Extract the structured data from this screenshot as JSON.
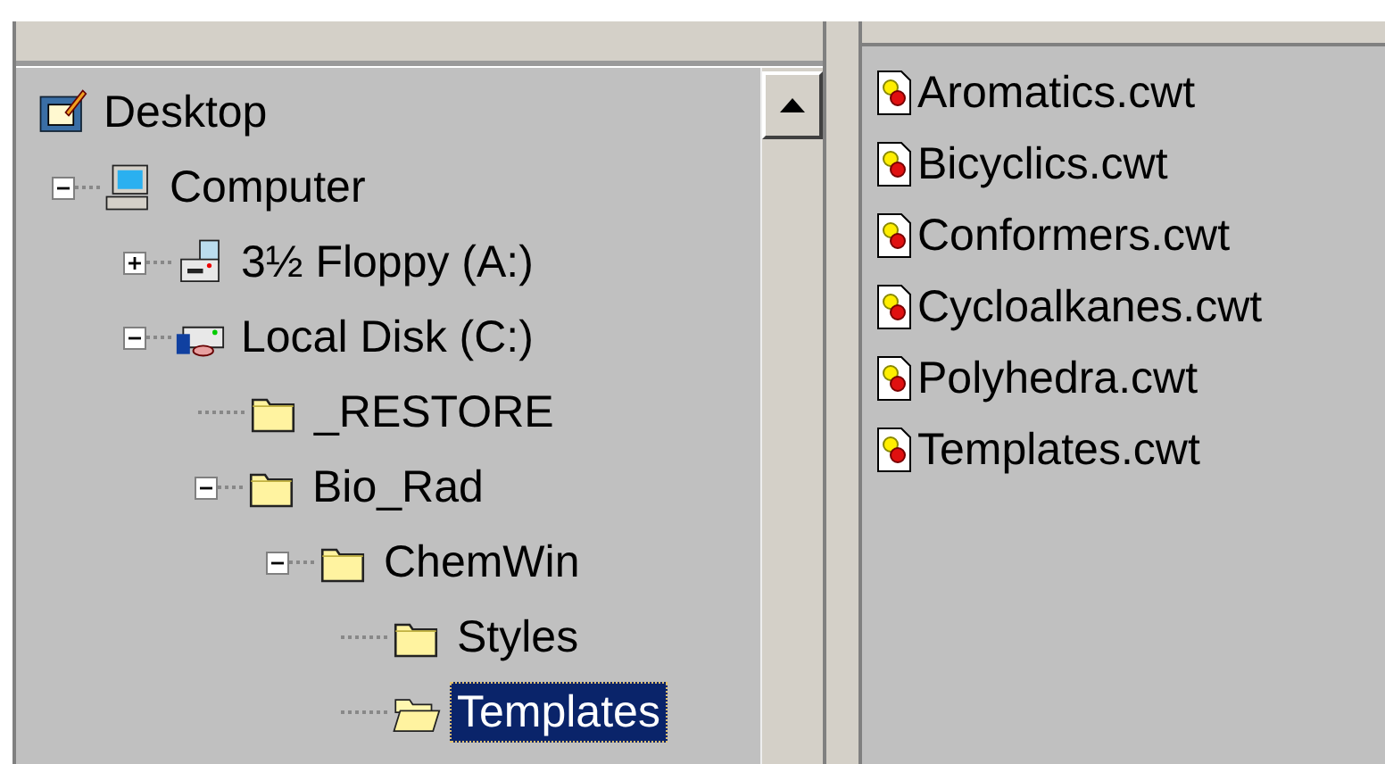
{
  "folders_pane": {
    "tree": [
      {
        "label": "Desktop",
        "kind": "desktop",
        "selected": false,
        "children": [
          {
            "label": "Computer",
            "kind": "computer",
            "selected": false,
            "expanded": true,
            "children": [
              {
                "label": "3½ Floppy (A:)",
                "kind": "floppy",
                "selected": false,
                "expanded": false
              },
              {
                "label": "Local Disk (C:)",
                "kind": "disk",
                "selected": false,
                "expanded": true,
                "children": [
                  {
                    "label": "_RESTORE",
                    "kind": "folder",
                    "selected": false
                  },
                  {
                    "label": "Bio_Rad",
                    "kind": "folder",
                    "selected": false,
                    "expanded": true,
                    "children": [
                      {
                        "label": "ChemWin",
                        "kind": "folder",
                        "selected": false,
                        "expanded": true,
                        "children": [
                          {
                            "label": "Styles",
                            "kind": "folder",
                            "selected": false
                          },
                          {
                            "label": "Templates",
                            "kind": "folder",
                            "selected": true
                          }
                        ]
                      }
                    ]
                  }
                ]
              }
            ]
          }
        ]
      }
    ]
  },
  "files_pane": {
    "files": [
      {
        "name": "Aromatics.cwt"
      },
      {
        "name": "Bicyclics.cwt"
      },
      {
        "name": "Conformers.cwt"
      },
      {
        "name": "Cycloalkanes.cwt"
      },
      {
        "name": "Polyhedra.cwt"
      },
      {
        "name": "Templates.cwt"
      }
    ]
  }
}
